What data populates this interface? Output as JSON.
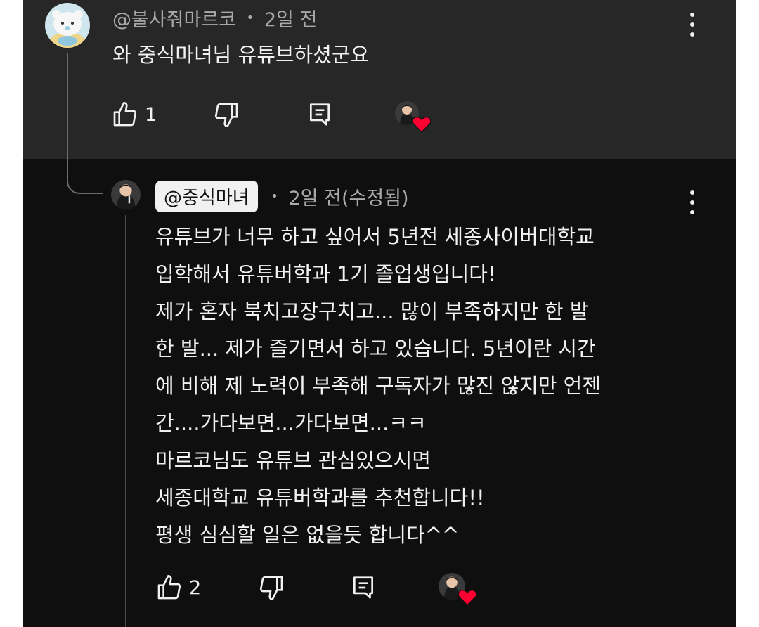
{
  "comment": {
    "author": "@불사줘마르코",
    "separator": "•",
    "time": "2일 전",
    "text": "와 중식마녀님 유튜브하셨군요",
    "like_count": "1"
  },
  "reply": {
    "author": "@중식마녀",
    "separator": "•",
    "time": "2일 전(수정됨)",
    "lines": [
      "유튜브가 너무 하고 싶어서 5년전 세종사이버대학교",
      "입학해서 유튜버학과 1기 졸업생입니다!",
      "제가 혼자 북치고장구치고... 많이 부족하지만 한 발",
      "한 발... 제가 즐기면서 하고 있습니다. 5년이란 시간",
      "에 비해 제 노력이 부족해 구독자가 많진 않지만 언젠",
      "간....가다보면...가다보면...ㅋㅋ",
      "마르코님도 유튜브 관심있으시면",
      "세종대학교 유튜버학과를 추천합니다!!",
      "평생 심심할 일은 없을듯 합니다^^"
    ],
    "like_count": "2"
  },
  "icons": {
    "like": "thumb-up-icon",
    "dislike": "thumb-down-icon",
    "reply": "comment-icon",
    "more": "more-vertical-icon",
    "creator_heart": "creator-heart-icon"
  },
  "colors": {
    "comment_bg": "#272727",
    "reply_bg": "#0f0f0f",
    "text": "#f1f1f1",
    "meta": "#a9a9a9",
    "heart": "#ff0033",
    "handle_pill": "#f1f1f1"
  }
}
